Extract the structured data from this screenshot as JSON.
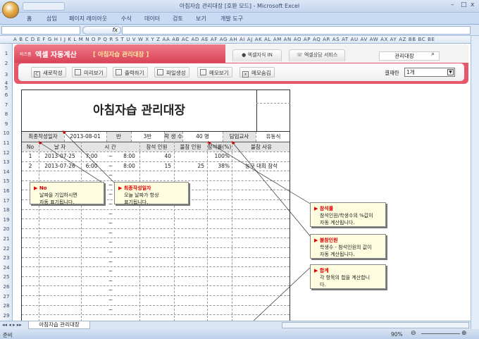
{
  "window": {
    "title": "아침자습 관리대장  [호환 모드] - Microsoft Excel",
    "min": "–",
    "max": "□",
    "close": "x"
  },
  "ribbon_tabs": [
    "홈",
    "삽입",
    "페이지 레이아웃",
    "수식",
    "데이터",
    "검토",
    "보기",
    "개발 도구"
  ],
  "formula": {
    "fx": "fx"
  },
  "columns": "A B C D E F G H I J K L M N O P Q R S T U V W X Y Z AA AB AC AD AE AF AG AH AI AJ AK AL AM AN AO AP AQ AR AS AT AU AV AW AX AY AZ BB BC BE",
  "rows": [
    "1",
    "2",
    "3",
    "4",
    "5",
    "6",
    "7",
    "8",
    "9",
    "10",
    "11",
    "12",
    "13",
    "14",
    "15",
    "16",
    "17",
    "18",
    "19",
    "20",
    "21",
    "22",
    "23",
    "24",
    "25",
    "26",
    "27",
    "28",
    "29"
  ],
  "banner": {
    "brand_small": "비즈폼",
    "brand": "엑셀 자동계산",
    "subtitle": "[ 아침자습 관리대장 ]",
    "nav": [
      "엑셀지식 IN",
      "엑셀상담 서비스"
    ],
    "search_value": "관리대장"
  },
  "toolbar": {
    "buttons": [
      "새로작성",
      "미리보기",
      "출력하기",
      "파일생성",
      "메모보기",
      "메모숨김"
    ],
    "result_label": "결재란",
    "result_value": "1개"
  },
  "sheet": {
    "title": "아침자습 관리대장",
    "info": {
      "date_label": "최종작성일자",
      "date": "2013-08-01",
      "class_label": "반",
      "class": "3반",
      "students_label": "학 생 수",
      "students": "40 명",
      "teacher_label": "담임교사",
      "teacher": "유동식"
    },
    "headers": [
      "No",
      "날  자",
      "시     간",
      "참석 인원",
      "불참 인원",
      "참석률(%)",
      "불참 사유"
    ],
    "rows": [
      {
        "no": "1",
        "date": "2013-07-25",
        "start": "7:00",
        "sep": "~",
        "end": "8:00",
        "present": "40",
        "absent": "",
        "rate": "100%",
        "reason": ""
      },
      {
        "no": "2",
        "date": "2013-07-26",
        "start": "6:00",
        "sep": "~",
        "end": "8:00",
        "present": "15",
        "absent": "25",
        "rate": "38%",
        "reason": "농구 대회 참석"
      }
    ],
    "tilde": "~"
  },
  "callouts": [
    {
      "title": "No",
      "body": "날짜을 기입하시면\n자동 표기됩니다."
    },
    {
      "title": "최종작성일자",
      "body": "오늘 날짜가 항상\n표기됩니다."
    },
    {
      "title": "참석률",
      "body": "참석인원/학생수의 %값이\n자동 계산됩니다."
    },
    {
      "title": "불참인원",
      "body": "학생수 - 참석인원의 값이\n자동 계산됩니다."
    },
    {
      "title": "합계",
      "body": "각 항목의 합을 계산합니\n다."
    }
  ],
  "sheet_tab": "아침자습 관리대장",
  "status": {
    "ready": "준비",
    "zoom": "90%"
  }
}
